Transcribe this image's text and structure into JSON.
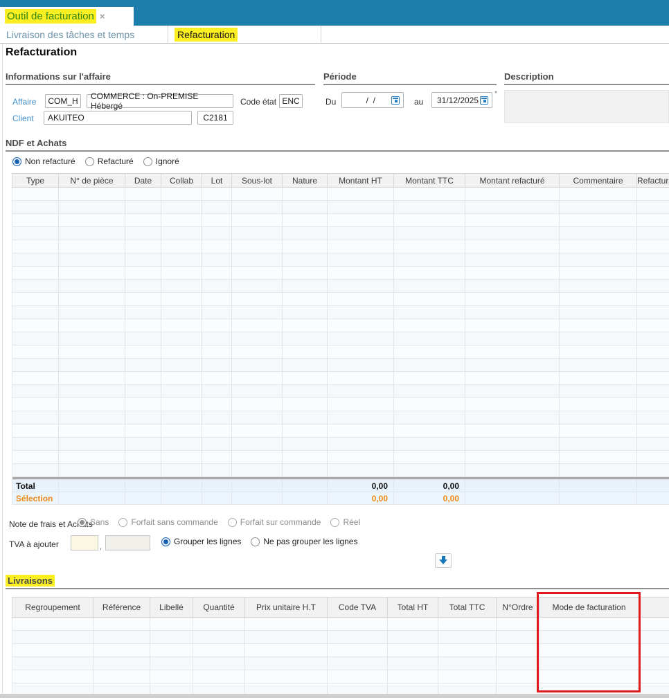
{
  "window_tab": {
    "title": "Outil de facturation",
    "close_glyph": "×"
  },
  "tabs": [
    {
      "label": "Livraison des tâches et temps",
      "active": false
    },
    {
      "label": "Refacturation",
      "active": true
    }
  ],
  "page_title": "Refacturation",
  "affaire_section": {
    "title": "Informations sur l'affaire",
    "affaire_label": "Affaire",
    "affaire_code": "COM_H",
    "affaire_name": "COMMERCE : On-PREMISE Hébergé",
    "code_etat_label": "Code état",
    "code_etat_value": "ENC",
    "client_label": "Client",
    "client_name": "AKUITEO",
    "client_code": "C2181"
  },
  "periode_section": {
    "title": "Période",
    "du_label": "Du",
    "du_value": "  /  /",
    "au_label": "au",
    "au_value": "31/12/2025",
    "required_marker": "*"
  },
  "description_section": {
    "title": "Description",
    "value": ""
  },
  "ndf_section": {
    "title": "NDF et Achats",
    "filter_radios": {
      "options": [
        "Non refacturé",
        "Refacturé",
        "Ignoré"
      ],
      "selected": 0,
      "disabled": false
    },
    "table": {
      "columns": [
        "Type",
        "N° de pièce",
        "Date",
        "Collab",
        "Lot",
        "Sous-lot",
        "Nature",
        "Montant HT",
        "Montant TTC",
        "Montant refacturé",
        "Commentaire",
        "Refactura"
      ],
      "empty_rows": 22,
      "total_row": {
        "label": "Total",
        "montant_ht": "0,00",
        "montant_ttc": "0,00"
      },
      "selection_row": {
        "label": "Sélection",
        "montant_ht": "0,00",
        "montant_ttc": "0,00"
      }
    },
    "note_frais": {
      "label": "Note de frais et Achats",
      "options": [
        "Sans",
        "Forfait sans commande",
        "Forfait sur commande",
        "Réel"
      ],
      "selected": 0,
      "disabled": true
    },
    "tva": {
      "label": "TVA à ajouter",
      "value_int": "",
      "decimal_separator": ",",
      "value_dec": "",
      "group_radios": {
        "options": [
          "Grouper les lignes",
          "Ne pas grouper les lignes"
        ],
        "selected": 0,
        "disabled": false
      }
    }
  },
  "livraisons_section": {
    "title": "Livraisons",
    "table": {
      "columns": [
        "Regroupement",
        "Référence",
        "Libellé",
        "Quantité",
        "Prix unitaire H.T",
        "Code TVA",
        "Total HT",
        "Total TTC",
        "N°Ordre",
        "Mode de facturation",
        ""
      ],
      "empty_rows": 6
    }
  },
  "colors": {
    "topbar_blue": "#1d7dad",
    "highlight_yellow": "#fbee21",
    "tab_title_green": "#35870e",
    "accent_blue": "#1262b8",
    "selection_orange": "#ef8913",
    "annotation_red": "#e01a1a"
  }
}
